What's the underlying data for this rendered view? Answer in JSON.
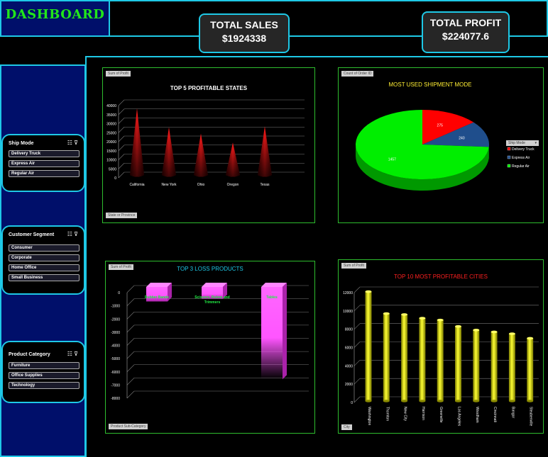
{
  "header": {
    "title": "DASHBOARD"
  },
  "kpis": [
    {
      "label": "TOTAL SALES",
      "value": "$1924338"
    },
    {
      "label": "TOTAL PROFIT",
      "value": "$224077.6"
    }
  ],
  "slicers": [
    {
      "title": "Ship Mode",
      "items": [
        "Delivery Truck",
        "Express Air",
        "Regular Air"
      ]
    },
    {
      "title": "Customer Segment",
      "items": [
        "Consumer",
        "Corporate",
        "Home Office",
        "Small Business"
      ]
    },
    {
      "title": "Product Category",
      "items": [
        "Furniture",
        "Office Supplies",
        "Technology"
      ]
    }
  ],
  "panels": {
    "states": {
      "field_tag": "Sum of Profit",
      "filter_tag": "State or Province"
    },
    "shipment": {
      "field_tag": "Count of Order ID",
      "legend_title": "Ship Mode"
    },
    "loss": {
      "field_tag": "Sum of Profit",
      "filter_tag": "Product Sub-Category"
    },
    "cities": {
      "field_tag": "Sum of Profit",
      "filter_tag": "City"
    }
  },
  "colors": {
    "accent": "#1ec8e6",
    "sidebar": "#000f6a",
    "title_green": "#22e61a",
    "panel_border": "#2ebd2e"
  },
  "chart_data": [
    {
      "type": "bar",
      "title": "TOP 5 PROFITABLE STATES",
      "categories": [
        "California",
        "New York",
        "Ohio",
        "Oregon",
        "Texas"
      ],
      "values": [
        38500,
        28000,
        24500,
        19500,
        28500
      ],
      "ylim": [
        0,
        40000
      ],
      "yticks": [
        "0",
        "5000",
        "10000",
        "15000",
        "20000",
        "25000",
        "30000",
        "35000",
        "40000"
      ]
    },
    {
      "type": "pie",
      "title": "MOST USED SHIPMENT MODE",
      "categories": [
        "Delivery Truck",
        "Express Air",
        "Regular Air"
      ],
      "values": [
        275,
        240,
        1457
      ],
      "labels": [
        "275",
        "240",
        "1457"
      ],
      "colors": [
        "#ff0000",
        "#1f4e8c",
        "#00ee00"
      ]
    },
    {
      "type": "bar",
      "title": "TOP 3 LOSS PRODUCTS",
      "categories": [
        "Rubber Bands",
        "Scissors, Rulers and Trimmers",
        "Tables"
      ],
      "values": [
        -1100,
        -900,
        -7000
      ],
      "ylim": [
        -8000,
        0
      ],
      "yticks": [
        "0",
        "-1000",
        "-2000",
        "-3000",
        "-4000",
        "-5000",
        "-6000",
        "-7000",
        "-8000"
      ]
    },
    {
      "type": "bar",
      "title": "TOP 10 MOST PROFITABLE CITIES",
      "categories": [
        "Washington",
        "Thornton",
        "New City",
        "Harrison",
        "Greenville",
        "Los Angeles",
        "Woodham",
        "Cincinnati",
        "Bangor",
        "Steubenville"
      ],
      "values": [
        11800,
        9400,
        9300,
        8900,
        8700,
        8000,
        7600,
        7400,
        7200,
        6700
      ],
      "ylim": [
        0,
        12000
      ],
      "yticks": [
        "0",
        "2000",
        "4000",
        "6000",
        "8000",
        "10000",
        "12000"
      ]
    }
  ]
}
